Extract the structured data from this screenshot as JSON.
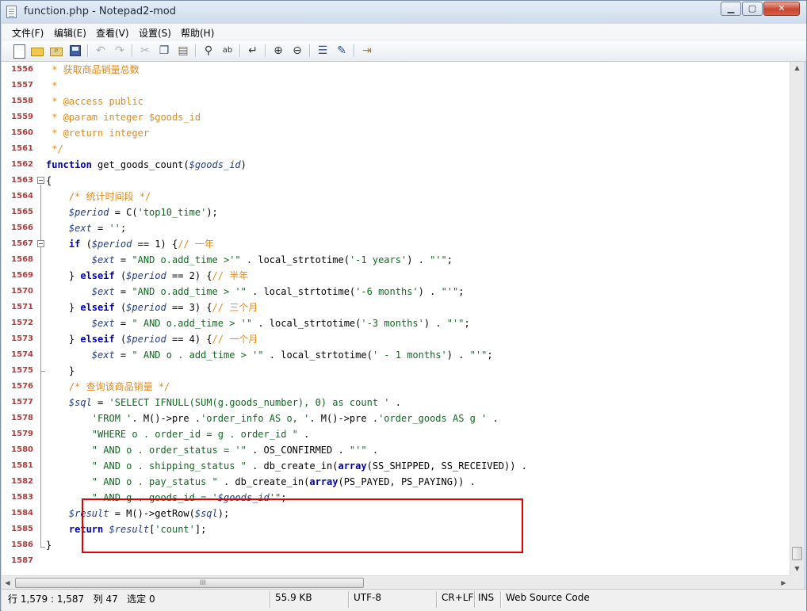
{
  "window": {
    "title": "function.php - Notepad2-mod",
    "minimize_glyph": "▁",
    "maximize_glyph": "▢",
    "close_glyph": "✕"
  },
  "menu": [
    "文件(F)",
    "编辑(E)",
    "查看(V)",
    "设置(S)",
    "帮助(H)"
  ],
  "toolbar": {
    "icons": [
      "new-file-icon",
      "open-folder-icon",
      "browse-icon",
      "save-icon",
      "undo-icon",
      "redo-icon",
      "cut-icon",
      "copy-icon",
      "paste-icon",
      "find-icon",
      "replace-icon",
      "wordwrap-icon",
      "zoom-in-icon",
      "zoom-out-icon",
      "scheme-icon",
      "customize-scheme-icon",
      "exit-icon"
    ]
  },
  "editor": {
    "lines": [
      {
        "n": "1556",
        "t": " * 获取商品销量总数"
      },
      {
        "n": "1557",
        "t": " *"
      },
      {
        "n": "1558",
        "t": " * @access public"
      },
      {
        "n": "1559",
        "t": " * @param integer $goods_id"
      },
      {
        "n": "1560",
        "t": " * @return integer"
      },
      {
        "n": "1561",
        "t": " */"
      },
      {
        "n": "1562",
        "t": "function get_goods_count($goods_id)"
      },
      {
        "n": "1563",
        "t": "{"
      },
      {
        "n": "1564",
        "t": "    /* 统计时间段 */"
      },
      {
        "n": "1565",
        "t": "    $period = C('top10_time');"
      },
      {
        "n": "1566",
        "t": "    $ext = '';"
      },
      {
        "n": "1567",
        "t": "    if ($period == 1) {// 一年"
      },
      {
        "n": "1568",
        "t": "        $ext = \"AND o.add_time >'\" . local_strtotime('-1 years') . \"'\";"
      },
      {
        "n": "1569",
        "t": "    } elseif ($period == 2) {// 半年"
      },
      {
        "n": "1570",
        "t": "        $ext = \"AND o.add_time > '\" . local_strtotime('-6 months') . \"'\";"
      },
      {
        "n": "1571",
        "t": "    } elseif ($period == 3) {// 三个月"
      },
      {
        "n": "1572",
        "t": "        $ext = \" AND o.add_time > '\" . local_strtotime('-3 months') . \"'\";"
      },
      {
        "n": "1573",
        "t": "    } elseif ($period == 4) {// 一个月"
      },
      {
        "n": "1574",
        "t": "        $ext = \" AND o . add_time > '\" . local_strtotime(' - 1 months') . \"'\";"
      },
      {
        "n": "1575",
        "t": "    }"
      },
      {
        "n": "1576",
        "t": "    /* 查询该商品销量 */"
      },
      {
        "n": "1577",
        "t": "    $sql = 'SELECT IFNULL(SUM(g.goods_number), 0) as count ' ."
      },
      {
        "n": "1578",
        "t": "        'FROM '. M()->pre .'order_info AS o, '. M()->pre .'order_goods AS g ' ."
      },
      {
        "n": "1579",
        "t": "        \"WHERE o . order_id = g . order_id \" ."
      },
      {
        "n": "1580",
        "t": "        \" AND o . order_status = '\" . OS_CONFIRMED . \"'\" ."
      },
      {
        "n": "1581",
        "t": "        \" AND o . shipping_status \" . db_create_in(array(SS_SHIPPED, SS_RECEIVED)) ."
      },
      {
        "n": "1582",
        "t": "        \" AND o . pay_status \" . db_create_in(array(PS_PAYED, PS_PAYING)) ."
      },
      {
        "n": "1583",
        "t": "        \" AND g . goods_id = '$goods_id'\";"
      },
      {
        "n": "1584",
        "t": "    $result = M()->getRow($sql);"
      },
      {
        "n": "1585",
        "t": "    return $result['count'];"
      },
      {
        "n": "1586",
        "t": "}"
      },
      {
        "n": "1587",
        "t": ""
      }
    ]
  },
  "scrollbar": {
    "grip": "III"
  },
  "status": {
    "position": "行 1,579 : 1,587   列 47   选定 0",
    "size": "55.9 KB",
    "encoding": "UTF-8",
    "eol": "CR+LF",
    "mode": "INS",
    "scheme": "Web Source Code"
  }
}
